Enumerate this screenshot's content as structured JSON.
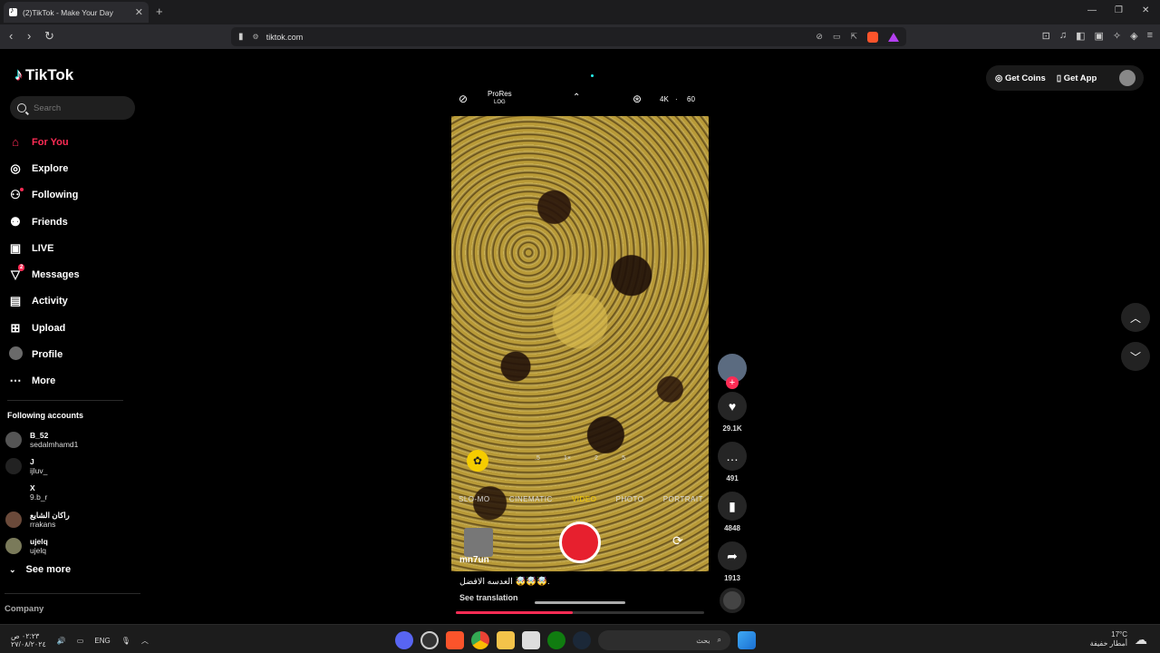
{
  "browser": {
    "tab_title": "(2)TikTok - Make Your Day",
    "url": "tiktok.com"
  },
  "sidebar": {
    "logo": "TikTok",
    "search_placeholder": "Search",
    "nav": [
      {
        "label": "For You",
        "icon": "home-icon"
      },
      {
        "label": "Explore",
        "icon": "compass-icon"
      },
      {
        "label": "Following",
        "icon": "person-follow-icon"
      },
      {
        "label": "Friends",
        "icon": "friends-icon"
      },
      {
        "label": "LIVE",
        "icon": "live-icon"
      },
      {
        "label": "Messages",
        "icon": "send-icon",
        "badge": "2"
      },
      {
        "label": "Activity",
        "icon": "inbox-icon"
      },
      {
        "label": "Upload",
        "icon": "upload-icon"
      },
      {
        "label": "Profile",
        "icon": "avatar"
      },
      {
        "label": "More",
        "icon": "more-icon"
      }
    ],
    "following_title": "Following accounts",
    "accounts": [
      {
        "name": "B_52",
        "handle": "sedalmhamd1"
      },
      {
        "name": "J",
        "handle": "ijluv_"
      },
      {
        "name": "X",
        "handle": "9.b_r"
      },
      {
        "name": "راكان الشايع",
        "handle": "rrakans"
      },
      {
        "name": "ujelq",
        "handle": "ujelq"
      }
    ],
    "see_more": "See more",
    "company": "Company"
  },
  "topright": {
    "get_coins": "Get Coins",
    "get_app": "Get App"
  },
  "camera": {
    "prores": "ProRes",
    "prores_sub": "LOG",
    "resolution": "4K",
    "separator": "·",
    "fps": "60",
    "zoom_levels": [
      ".5",
      "1×",
      "2",
      "5"
    ],
    "modes": [
      "SLO-MO",
      "CINEMATIC",
      "VIDEO",
      "PHOTO",
      "PORTRAIT"
    ],
    "selected_mode": "VIDEO"
  },
  "video": {
    "watermark": "mn7un",
    "caption": "العدسه الافضل 🤯🤯🤯.",
    "see_translation": "See translation",
    "progress": 0.47
  },
  "actions": {
    "likes": "29.1K",
    "comments": "491",
    "saves": "4848",
    "shares": "1913"
  },
  "taskbar": {
    "time": "٠٢:٢٣ ص",
    "date": "٢٧/٠٨/٢٠٢٤",
    "lang": "ENG",
    "search_label": "بحث",
    "temp": "17°C",
    "weather": "أمطار خفيفة"
  },
  "colors": {
    "accent": "#fe2c55",
    "mode_selected": "#f5cc00",
    "shutter": "#e7202e"
  }
}
